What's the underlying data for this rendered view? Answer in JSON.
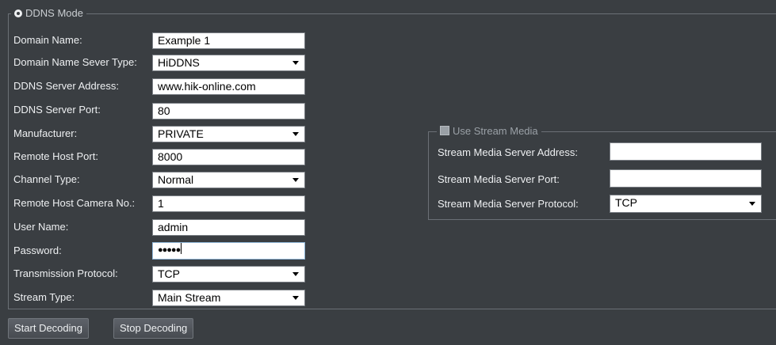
{
  "ddns": {
    "legend": "DDNS Mode",
    "rows": [
      {
        "label": "Domain Name:",
        "value": "Example 1",
        "type": "text"
      },
      {
        "label": "Domain Name Sever Type:",
        "value": "HiDDNS",
        "type": "select"
      },
      {
        "label": "DDNS Server Address:",
        "value": "www.hik-online.com",
        "type": "text"
      },
      {
        "label": "DDNS Server Port:",
        "value": "80",
        "type": "text"
      },
      {
        "label": "Manufacturer:",
        "value": "PRIVATE",
        "type": "select"
      },
      {
        "label": "Remote Host Port:",
        "value": "8000",
        "type": "text"
      },
      {
        "label": "Channel Type:",
        "value": "Normal",
        "type": "select"
      },
      {
        "label": "Remote Host Camera No.:",
        "value": "1",
        "type": "text"
      },
      {
        "label": "User Name:",
        "value": "admin",
        "type": "text"
      },
      {
        "label": "Password:",
        "value": "●●●●●",
        "type": "password"
      },
      {
        "label": "Transmission Protocol:",
        "value": "TCP",
        "type": "select"
      },
      {
        "label": "Stream Type:",
        "value": "Main Stream",
        "type": "select"
      }
    ]
  },
  "stream_media": {
    "legend": "Use Stream Media",
    "rows": [
      {
        "label": "Stream Media Server Address:",
        "value": "",
        "type": "text"
      },
      {
        "label": "Stream Media Server Port:",
        "value": "",
        "type": "text"
      },
      {
        "label": "Stream Media Server Protocol:",
        "value": "TCP",
        "type": "select"
      }
    ]
  },
  "buttons": {
    "start_decoding": "Start Decoding",
    "stop_decoding": "Stop Decoding"
  },
  "icons": {
    "ddns_mode": "radio-selected-icon",
    "use_stream_media": "checkbox-disabled-icon",
    "dropdown": "chevron-down-icon"
  }
}
